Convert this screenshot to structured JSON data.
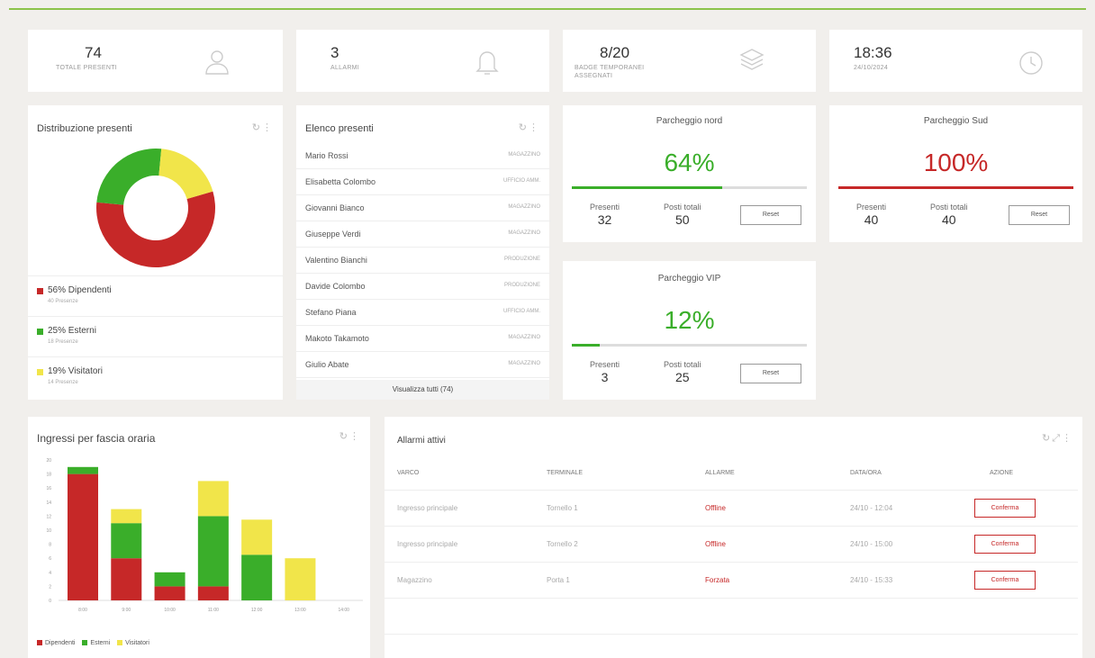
{
  "colors": {
    "red": "#c62828",
    "green": "#3aae2a",
    "yellow": "#f1e54a",
    "accent": "#8bc34a"
  },
  "kpis": [
    {
      "value": "74",
      "label": "TOTALE PRESENTI",
      "icon": "user-icon"
    },
    {
      "value": "3",
      "label": "ALLARMI",
      "icon": "bell-icon"
    },
    {
      "value": "8/20",
      "label": "BADGE TEMPORANEI ASSEGNATI",
      "icon": "layers-icon"
    },
    {
      "value": "18:36",
      "label": "24/10/2024",
      "icon": "clock-icon"
    }
  ],
  "distribution": {
    "title": "Distribuzione presenti",
    "slices": [
      {
        "label": "56% Dipendenti",
        "sub": "40 Presenze",
        "percent": 56,
        "color": "#c62828"
      },
      {
        "label": "25% Esterni",
        "sub": "18 Presenze",
        "percent": 25,
        "color": "#3aae2a"
      },
      {
        "label": "19% Visitatori",
        "sub": "14 Presenze",
        "percent": 19,
        "color": "#f1e54a"
      }
    ]
  },
  "present_list": {
    "title": "Elenco presenti",
    "rows": [
      {
        "name": "Mario Rossi",
        "role": "MAGAZZINO"
      },
      {
        "name": "Elisabetta Colombo",
        "role": "UFFICIO AMM."
      },
      {
        "name": "Giovanni Bianco",
        "role": "MAGAZZINO"
      },
      {
        "name": "Giuseppe Verdi",
        "role": "MAGAZZINO"
      },
      {
        "name": "Valentino Bianchi",
        "role": "PRODUZIONE"
      },
      {
        "name": "Davide Colombo",
        "role": "PRODUZIONE"
      },
      {
        "name": "Stefano Piana",
        "role": "UFFICIO AMM."
      },
      {
        "name": "Makoto Takamoto",
        "role": "MAGAZZINO"
      },
      {
        "name": "Giulio Abate",
        "role": "MAGAZZINO"
      }
    ],
    "view_all": "Visualizza tutti (74)"
  },
  "parking": [
    {
      "title": "Parcheggio nord",
      "percent_label": "64%",
      "percent": 64,
      "color": "#3aae2a",
      "present_label": "Presenti",
      "present": "32",
      "total_label": "Posti totali",
      "total": "50",
      "reset": "Reset"
    },
    {
      "title": "Parcheggio Sud",
      "percent_label": "100%",
      "percent": 100,
      "color": "#c62828",
      "present_label": "Presenti",
      "present": "40",
      "total_label": "Posti totali",
      "total": "40",
      "reset": "Reset"
    },
    {
      "title": "Parcheggio VIP",
      "percent_label": "12%",
      "percent": 12,
      "color": "#3aae2a",
      "present_label": "Presenti",
      "present": "3",
      "total_label": "Posti totali",
      "total": "25",
      "reset": "Reset"
    }
  ],
  "chart_data": {
    "type": "bar",
    "stacked": true,
    "title": "Ingressi per fascia oraria",
    "categories": [
      "8:00",
      "9:00",
      "10:00",
      "11:00",
      "12:00",
      "13:00",
      "14:00"
    ],
    "series": [
      {
        "name": "Dipendenti",
        "color": "#c62828",
        "values": [
          18,
          6,
          2,
          2,
          0,
          0,
          0
        ]
      },
      {
        "name": "Esterni",
        "color": "#3aae2a",
        "values": [
          1,
          5,
          2,
          10,
          6.5,
          0,
          0
        ]
      },
      {
        "name": "Visitatori",
        "color": "#f1e54a",
        "values": [
          0,
          2,
          0,
          5,
          5,
          6,
          0
        ]
      }
    ],
    "ylim": [
      0,
      20
    ],
    "yticks": [
      0,
      2,
      4,
      6,
      8,
      10,
      12,
      14,
      16,
      18,
      20
    ],
    "grid": false,
    "legend": "bottom-left"
  },
  "alarms": {
    "title": "Allarmi attivi",
    "columns": [
      "VARCO",
      "TERMINALE",
      "ALLARME",
      "DATA/ORA",
      "AZIONE"
    ],
    "rows": [
      {
        "gate": "Ingresso principale",
        "terminal": "Tornello 1",
        "alarm": "Offline",
        "datetime": "24/10 - 12:04",
        "action": "Conferma"
      },
      {
        "gate": "Ingresso principale",
        "terminal": "Tornello 2",
        "alarm": "Offline",
        "datetime": "24/10 - 15:00",
        "action": "Conferma"
      },
      {
        "gate": "Magazzino",
        "terminal": "Porta 1",
        "alarm": "Forzata",
        "datetime": "24/10 - 15:33",
        "action": "Conferma"
      }
    ]
  }
}
